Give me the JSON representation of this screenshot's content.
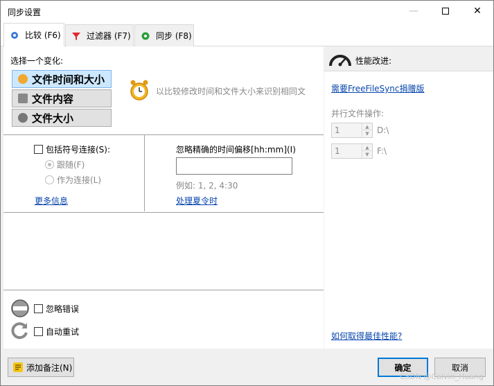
{
  "window": {
    "title": "同步设置",
    "minimize_icon": "minimize-icon",
    "maximize_icon": "maximize-icon",
    "close_icon": "close-icon"
  },
  "tabs": [
    {
      "label": "比较 (F6)",
      "icon": "gear-icon",
      "active": true
    },
    {
      "label": "过滤器 (F7)",
      "icon": "funnel-icon",
      "active": false
    },
    {
      "label": "同步 (F8)",
      "icon": "green-gear-icon",
      "active": false
    }
  ],
  "compare": {
    "select_label": "选择一个变化:",
    "variants": [
      {
        "label": "文件时间和大小",
        "icon": "clock-icon",
        "selected": true
      },
      {
        "label": "文件内容",
        "icon": "file-content-icon",
        "selected": false
      },
      {
        "label": "文件大小",
        "icon": "file-size-icon",
        "selected": false
      }
    ],
    "description": "以比较修改时间和文件大小来识别相同文",
    "description_icon": "alarm-clock-icon"
  },
  "symlinks": {
    "checkbox_label": "包括符号连接(S):",
    "radio_follow": "跟随(F)",
    "radio_as_link": "作为连接(L)",
    "more_info": "更多信息"
  },
  "time_offset": {
    "label": "忽略精确的时间偏移[hh:mm](I)",
    "value": "",
    "example": "例如: 1, 2, 4:30",
    "dst_link": "处理夏令时"
  },
  "errors": {
    "ignore_errors": "忽略错误",
    "auto_retry": "自动重试"
  },
  "performance": {
    "title": "性能改进:",
    "donation_link": "需要FreeFileSync捐赠版",
    "parallel_label": "并行文件操作:",
    "rows": [
      {
        "value": "1",
        "drive": "D:\\"
      },
      {
        "value": "1",
        "drive": "F:\\"
      }
    ],
    "best_link": "如何取得最佳性能?"
  },
  "footer": {
    "add_note": "添加备注(N)",
    "ok": "确定",
    "cancel": "取消",
    "watermark": "CSDN @Calvin_Huang"
  },
  "colors": {
    "accent": "#0078d7",
    "link": "#0645ad",
    "selected_bg": "#cce8ff"
  }
}
